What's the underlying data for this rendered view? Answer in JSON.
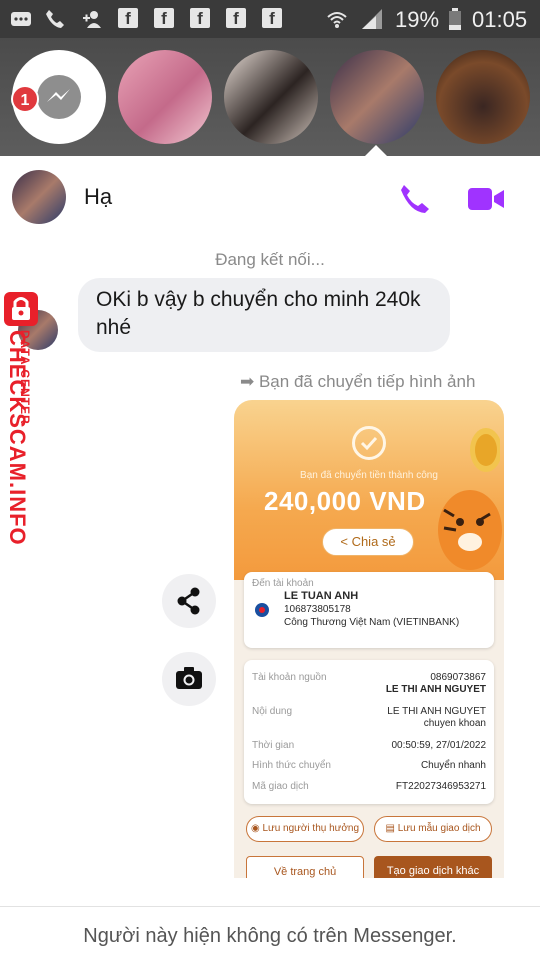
{
  "status_bar": {
    "battery": "19%",
    "time": "01:05",
    "icons": [
      "chat-bubble-icon",
      "phone-icon",
      "add-contact-icon",
      "facebook-icon",
      "facebook-icon",
      "facebook-icon",
      "facebook-icon",
      "facebook-icon",
      "wifi-icon",
      "signal-icon",
      "battery-icon"
    ]
  },
  "chat_heads": {
    "badge": "1",
    "count": 5
  },
  "conversation": {
    "contact_name": "Hạ",
    "connecting": "Đang kết nối...",
    "message": "OKi b vậy b chuyển cho minh 240k nhé",
    "forwarded": "➡ Bạn đã chuyển tiếp hình ảnh"
  },
  "receipt": {
    "subtitle": "Bạn đã chuyển tiền thành công",
    "amount": "240,000 VND",
    "share": "Chia sẻ",
    "to_account_label": "Đến tài khoản",
    "recipient_name": "LE TUAN ANH",
    "recipient_account": "106873805178",
    "recipient_bank": "Công Thương Việt Nam (VIETINBANK)",
    "rows": [
      {
        "label": "Tài khoản nguồn",
        "value": "0869073867"
      },
      {
        "label": "",
        "value": "LE THI ANH NGUYET"
      },
      {
        "label": "Nội dung",
        "value": "LE THI ANH NGUYET"
      },
      {
        "label": "",
        "value": "chuyen khoan"
      },
      {
        "label": "Thời gian",
        "value": "00:50:59, 27/01/2022"
      },
      {
        "label": "Hình thức chuyển",
        "value": "Chuyển nhanh"
      },
      {
        "label": "Mã giao dịch",
        "value": "FT22027346953271"
      }
    ],
    "save_beneficiary": "Lưu người thụ hưởng",
    "save_template": "Lưu mẫu giao dịch",
    "home": "Về trang chủ",
    "new_transaction": "Tạo giao dịch khác"
  },
  "footer": {
    "text": "Người này hiện không có trên Messenger."
  },
  "watermark": {
    "line1": "DATA CENTER",
    "line2": "CHECKSCAM.INFO"
  },
  "colors": {
    "accent": "#a033ff",
    "status_bar": "#3a3a3a",
    "bubble": "#eeeff2",
    "receipt_orange": "#f5a94f",
    "watermark": "#e8202a"
  }
}
